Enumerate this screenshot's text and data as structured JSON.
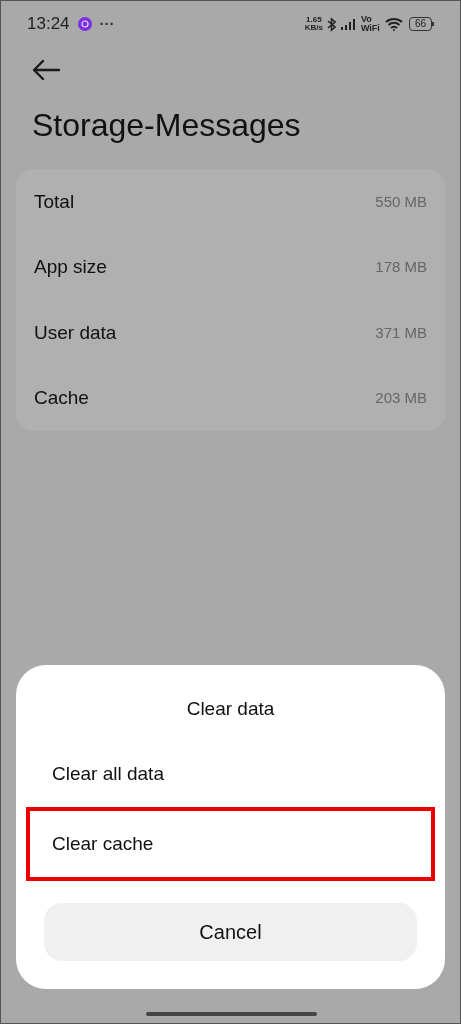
{
  "status_bar": {
    "time": "13:24",
    "more": "···",
    "speed": [
      "1.65",
      "KB/s"
    ],
    "volte": [
      "Vo",
      "WiFi"
    ],
    "battery": "66"
  },
  "page": {
    "title": "Storage-Messages"
  },
  "storage_rows": [
    {
      "label": "Total",
      "value": "550 MB"
    },
    {
      "label": "App size",
      "value": "178 MB"
    },
    {
      "label": "User data",
      "value": "371 MB"
    },
    {
      "label": "Cache",
      "value": "203 MB"
    }
  ],
  "dialog": {
    "title": "Clear data",
    "options": [
      {
        "label": "Clear all data",
        "highlighted": false
      },
      {
        "label": "Clear cache",
        "highlighted": true
      }
    ],
    "cancel": "Cancel"
  }
}
